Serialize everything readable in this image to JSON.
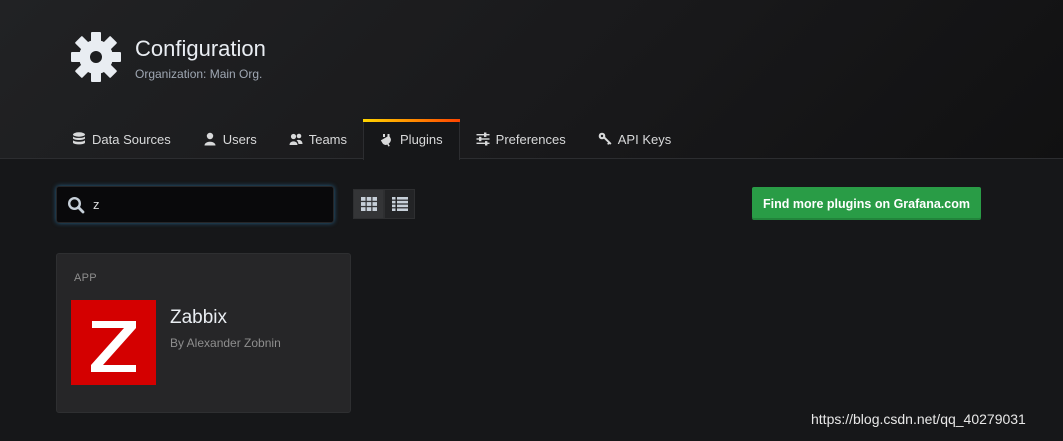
{
  "header": {
    "icon": "gear-icon",
    "title": "Configuration",
    "subtitle": "Organization: Main Org."
  },
  "tabs": [
    {
      "label": "Data Sources",
      "icon": "database-icon",
      "active": false
    },
    {
      "label": "Users",
      "icon": "user-icon",
      "active": false
    },
    {
      "label": "Teams",
      "icon": "users-icon",
      "active": false
    },
    {
      "label": "Plugins",
      "icon": "plug-icon",
      "active": true
    },
    {
      "label": "Preferences",
      "icon": "sliders-icon",
      "active": false
    },
    {
      "label": "API Keys",
      "icon": "key-icon",
      "active": false
    }
  ],
  "search": {
    "value": "z",
    "icon": "search-icon"
  },
  "view_toggle": {
    "selected": "grid",
    "options": [
      "grid",
      "list"
    ]
  },
  "actions": {
    "find_more_label": "Find more plugins on Grafana.com"
  },
  "plugins": [
    {
      "type": "APP",
      "name": "Zabbix",
      "author": "By Alexander Zobnin",
      "logo_letter": "Z",
      "logo_color": "#d40000"
    }
  ],
  "watermark": "https://blog.csdn.net/qq_40279031",
  "colors": {
    "accent_green": "#299c46",
    "tab_gradient_start": "#ffd500",
    "tab_gradient_end": "#ff4400",
    "focus_glow": "#33a1e5"
  }
}
